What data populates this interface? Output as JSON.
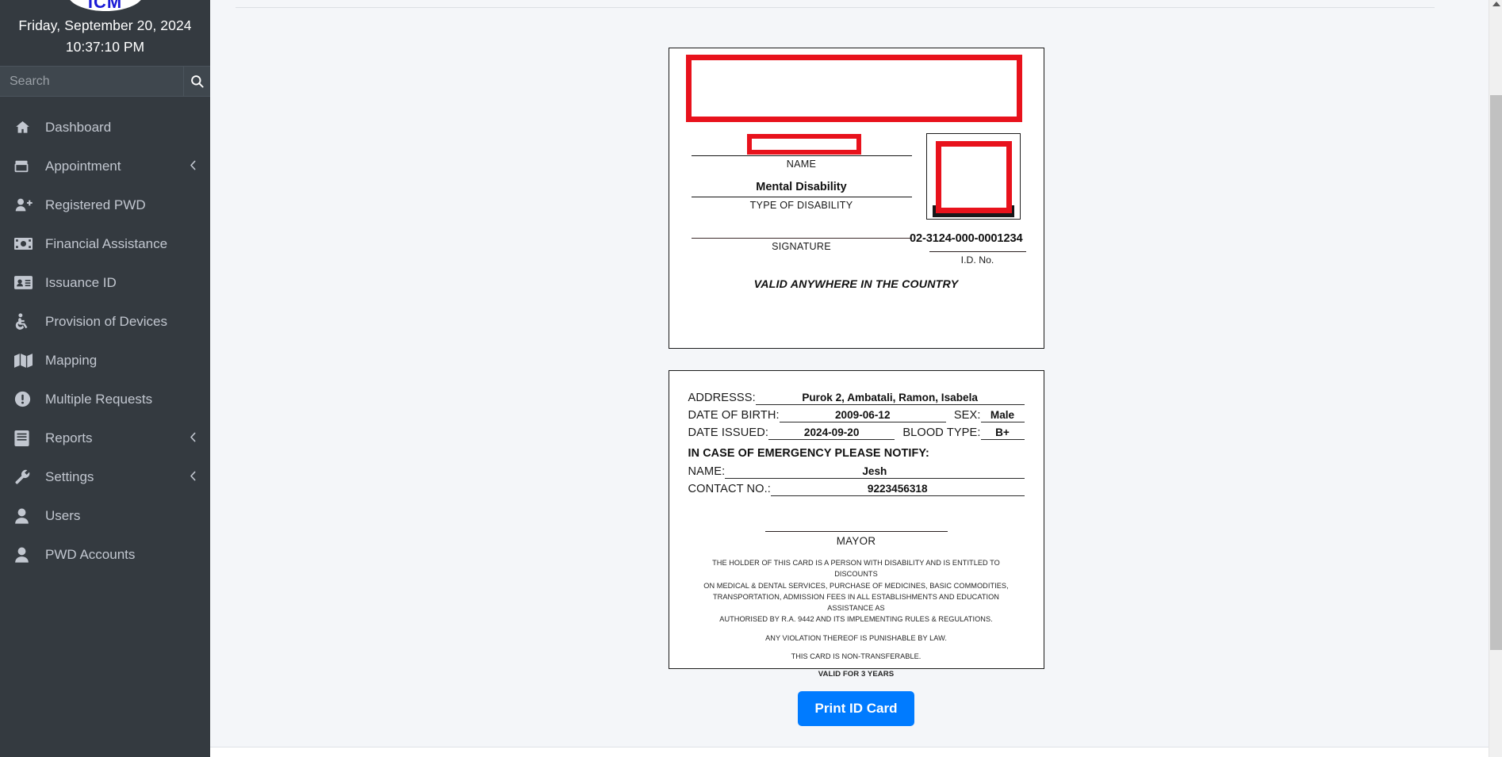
{
  "sidebar": {
    "logo_text": "ICM",
    "date": "Friday, September 20, 2024",
    "time": "10:37:10 PM",
    "search": {
      "placeholder": "Search",
      "value": "",
      "icon": "search-icon"
    },
    "items": [
      {
        "label": "Dashboard",
        "icon": "home-icon",
        "caret": false
      },
      {
        "label": "Appointment",
        "icon": "calendar-icon",
        "caret": true
      },
      {
        "label": "Registered PWD",
        "icon": "user-plus-icon",
        "caret": false
      },
      {
        "label": "Financial Assistance",
        "icon": "money-bill-icon",
        "caret": false
      },
      {
        "label": "Issuance ID",
        "icon": "id-card-icon",
        "caret": false
      },
      {
        "label": "Provision of Devices",
        "icon": "wheelchair-icon",
        "caret": false
      },
      {
        "label": "Mapping",
        "icon": "map-icon",
        "caret": false
      },
      {
        "label": "Multiple Requests",
        "icon": "exclamation-circle-icon",
        "caret": false
      },
      {
        "label": "Reports",
        "icon": "book-icon",
        "caret": true
      },
      {
        "label": "Settings",
        "icon": "wrench-icon",
        "caret": true
      },
      {
        "label": "Users",
        "icon": "user-icon",
        "caret": false
      },
      {
        "label": "PWD Accounts",
        "icon": "user-icon",
        "caret": false
      }
    ],
    "caret_icon": "chevron-left-icon"
  },
  "id_card_front": {
    "header_redacted": "",
    "name_redacted": "",
    "name_caption": "NAME",
    "disability_type": "Mental Disability",
    "disability_caption": "TYPE OF DISABILITY",
    "signature_caption": "SIGNATURE",
    "id_number": "02-3124-000-0001234",
    "id_number_caption": "I.D. No.",
    "validity_note": "VALID ANYWHERE IN THE COUNTRY",
    "photo_placeholder": ""
  },
  "id_card_back": {
    "address_label": "ADDRESSS:",
    "address_value": "Purok 2, Ambatali, Ramon, Isabela",
    "dob_label": "DATE OF BIRTH:",
    "dob_value": "2009-06-12",
    "sex_label": "SEX:",
    "sex_value": "Male",
    "date_issued_label": "DATE ISSUED:",
    "date_issued_value": "2024-09-20",
    "blood_type_label": "BLOOD TYPE:",
    "blood_type_value": "B+",
    "emergency_heading": "IN CASE OF EMERGENCY PLEASE NOTIFY:",
    "emergency_name_label": "NAME:",
    "emergency_name_value": "Jesh",
    "emergency_contact_label": "CONTACT NO.:",
    "emergency_contact_value": "9223456318",
    "mayor_caption": "MAYOR",
    "fineprint_1": "THE HOLDER OF THIS CARD IS A PERSON WITH DISABILITY AND IS ENTITLED TO DISCOUNTS",
    "fineprint_2": "ON MEDICAL & DENTAL SERVICES, PURCHASE OF MEDICINES, BASIC COMMODITIES,",
    "fineprint_3": "TRANSPORTATION, ADMISSION FEES IN ALL ESTABLISHMENTS AND EDUCATION ASSISTANCE AS",
    "fineprint_4": "AUTHORISED BY R.A. 9442 AND ITS IMPLEMENTING RULES & REGULATIONS.",
    "fineprint_5": "ANY VIOLATION THEREOF IS PUNISHABLE BY LAW.",
    "fineprint_6": "THIS CARD IS NON-TRANSFERABLE.",
    "fineprint_7": "VALID FOR 3 YEARS"
  },
  "actions": {
    "print_label": "Print ID Card"
  },
  "colors": {
    "sidebar_bg": "#343a40",
    "accent_blue": "#007bff",
    "redaction_red": "#e8121c",
    "content_bg": "#f4f6f9"
  }
}
